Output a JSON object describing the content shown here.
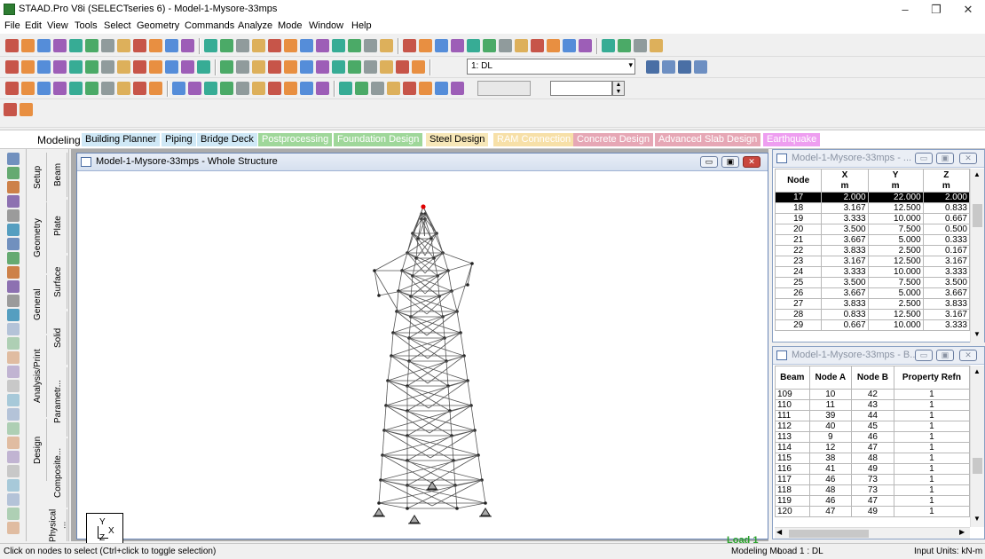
{
  "app": {
    "title": "STAAD.Pro V8i (SELECTseries 6) - Model-1-Mysore-33mps",
    "controls": {
      "minimize": "–",
      "maximize": "❐",
      "close": "✕"
    }
  },
  "menu": [
    "File",
    "Edit",
    "View",
    "Tools",
    "Select",
    "Geometry",
    "Commands",
    "Analyze",
    "Mode",
    "Window",
    "Help"
  ],
  "toolbar": {
    "load_case": "1: DL",
    "load_case_num": "1 :",
    "load_case_name": "DL"
  },
  "page_tabs": [
    {
      "label": "Modeling",
      "color": "#ffffff",
      "text": "#000000"
    },
    {
      "label": "Building Planner",
      "color": "#cfe8f6",
      "text": "#000000"
    },
    {
      "label": "Piping",
      "color": "#cfe8f6",
      "text": "#000000"
    },
    {
      "label": "Bridge Deck",
      "color": "#cfe8f6",
      "text": "#000000"
    },
    {
      "label": "Postprocessing",
      "color": "#9fd79a",
      "text": "#ffffff"
    },
    {
      "label": "Foundation Design",
      "color": "#9fd79a",
      "text": "#ffffff"
    },
    {
      "label": "Steel Design",
      "color": "#f7e7b8",
      "text": "#000000"
    },
    {
      "label": "RAM Connection",
      "color": "#f7e0a8",
      "text": "#ffffff"
    },
    {
      "label": "Concrete Design",
      "color": "#e6a7b5",
      "text": "#ffffff"
    },
    {
      "label": "Advanced Slab Design",
      "color": "#e6a7b5",
      "text": "#ffffff"
    },
    {
      "label": "Earthquake",
      "color": "#ee9ef0",
      "text": "#ffffff"
    }
  ],
  "side_tabs": {
    "group1": [
      "Setup",
      "Geometry",
      "General",
      "Analysis/Print",
      "Design"
    ],
    "group2": [
      "Beam",
      "Plate",
      "Surface",
      "Solid",
      "Parametr...",
      "Composite...",
      "Physical ..."
    ]
  },
  "structure_window": {
    "title": "Model-1-Mysore-33mps - Whole Structure",
    "load_label": "Load 1",
    "axes": {
      "y": "Y",
      "x": "X",
      "z": "Z"
    }
  },
  "node_table": {
    "title": "Model-1-Mysore-33mps - ...",
    "headers": [
      [
        "Node",
        ""
      ],
      [
        "X",
        "m"
      ],
      [
        "Y",
        "m"
      ],
      [
        "Z",
        "m"
      ]
    ],
    "rows": [
      [
        "17",
        "2.000",
        "22.000",
        "2.000"
      ],
      [
        "18",
        "3.167",
        "12.500",
        "0.833"
      ],
      [
        "19",
        "3.333",
        "10.000",
        "0.667"
      ],
      [
        "20",
        "3.500",
        "7.500",
        "0.500"
      ],
      [
        "21",
        "3.667",
        "5.000",
        "0.333"
      ],
      [
        "22",
        "3.833",
        "2.500",
        "0.167"
      ],
      [
        "23",
        "3.167",
        "12.500",
        "3.167"
      ],
      [
        "24",
        "3.333",
        "10.000",
        "3.333"
      ],
      [
        "25",
        "3.500",
        "7.500",
        "3.500"
      ],
      [
        "26",
        "3.667",
        "5.000",
        "3.667"
      ],
      [
        "27",
        "3.833",
        "2.500",
        "3.833"
      ],
      [
        "28",
        "0.833",
        "12.500",
        "3.167"
      ],
      [
        "29",
        "0.667",
        "10.000",
        "3.333"
      ]
    ]
  },
  "beam_table": {
    "title": "Model-1-Mysore-33mps - B...",
    "headers": [
      "Beam",
      "Node A",
      "Node B",
      "Property Refn"
    ],
    "rows": [
      [
        "109",
        "10",
        "42",
        "1"
      ],
      [
        "110",
        "11",
        "43",
        "1"
      ],
      [
        "111",
        "39",
        "44",
        "1"
      ],
      [
        "112",
        "40",
        "45",
        "1"
      ],
      [
        "113",
        "9",
        "46",
        "1"
      ],
      [
        "114",
        "12",
        "47",
        "1"
      ],
      [
        "115",
        "38",
        "48",
        "1"
      ],
      [
        "116",
        "41",
        "49",
        "1"
      ],
      [
        "117",
        "46",
        "73",
        "1"
      ],
      [
        "118",
        "48",
        "73",
        "1"
      ],
      [
        "119",
        "46",
        "47",
        "1"
      ],
      [
        "120",
        "47",
        "49",
        "1"
      ]
    ]
  },
  "status": {
    "left": "Click on nodes to select (Ctrl+click to toggle selection)",
    "mode": "Modeling Mo",
    "load": "Load 1 : DL",
    "units": "Input Units:  kN-m"
  },
  "colors": {
    "selected_node": "#e00000",
    "load_label": "#2aa12a"
  }
}
